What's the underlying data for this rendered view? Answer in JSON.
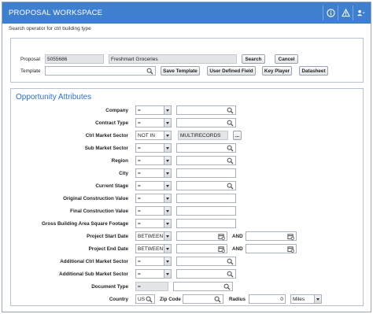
{
  "window": {
    "title": "PROPOSAL WORKSPACE",
    "subtitle": "Search operator for ctrl building type"
  },
  "header_icons": [
    "info-icon",
    "warning-icon",
    "user-menu-icon"
  ],
  "proposal": {
    "label": "Proposal",
    "number": "5055686",
    "name": "Freshmart Groceries",
    "search_label": "Search",
    "cancel_label": "Cancel",
    "template_label": "Template",
    "template_value": "",
    "buttons": {
      "save_template": "Save Template",
      "user_defined": "User Defined Field",
      "key_player": "Key Player",
      "datasheet": "Datasheet"
    }
  },
  "attributes": {
    "title": "Opportunity Attributes",
    "rows": {
      "company": {
        "label": "Company",
        "op": "="
      },
      "contract_type": {
        "label": "Contract Type",
        "op": "="
      },
      "ctrl_market_sector": {
        "label": "Ctrl Market Sector",
        "op": "NOT IN",
        "value": "MULTIRECORDS",
        "more": "..."
      },
      "sub_market_sector": {
        "label": "Sub Market Sector",
        "op": "="
      },
      "region": {
        "label": "Region",
        "op": "="
      },
      "city": {
        "label": "City",
        "op": "="
      },
      "current_stage": {
        "label": "Current Stage",
        "op": "="
      },
      "orig_construction": {
        "label": "Original Construction Value",
        "op": "="
      },
      "final_construction": {
        "label": "Final Construction Value",
        "op": "="
      },
      "gross_building": {
        "label": "Gross Building Area Square Footage",
        "op": "="
      },
      "project_start": {
        "label": "Project Start Date",
        "op": "BETWEEN",
        "and": "AND"
      },
      "project_end": {
        "label": "Project End Date",
        "op": "BETWEEN",
        "and": "AND"
      },
      "add_ctrl_market": {
        "label": "Additional Ctrl Market Sector",
        "op": "="
      },
      "add_sub_market": {
        "label": "Additional Sub Market Sector",
        "op": "="
      },
      "document_type": {
        "label": "Document Type",
        "op": "="
      },
      "country": {
        "label": "Country",
        "value": "US",
        "zip_label": "Zip Code",
        "radius_label": "Radius",
        "radius_value": "0",
        "unit": "Miles"
      }
    }
  },
  "colors": {
    "header": "#3f7fd0",
    "accent_title": "#2f6fc0",
    "readonly": "#e3e5e8"
  }
}
